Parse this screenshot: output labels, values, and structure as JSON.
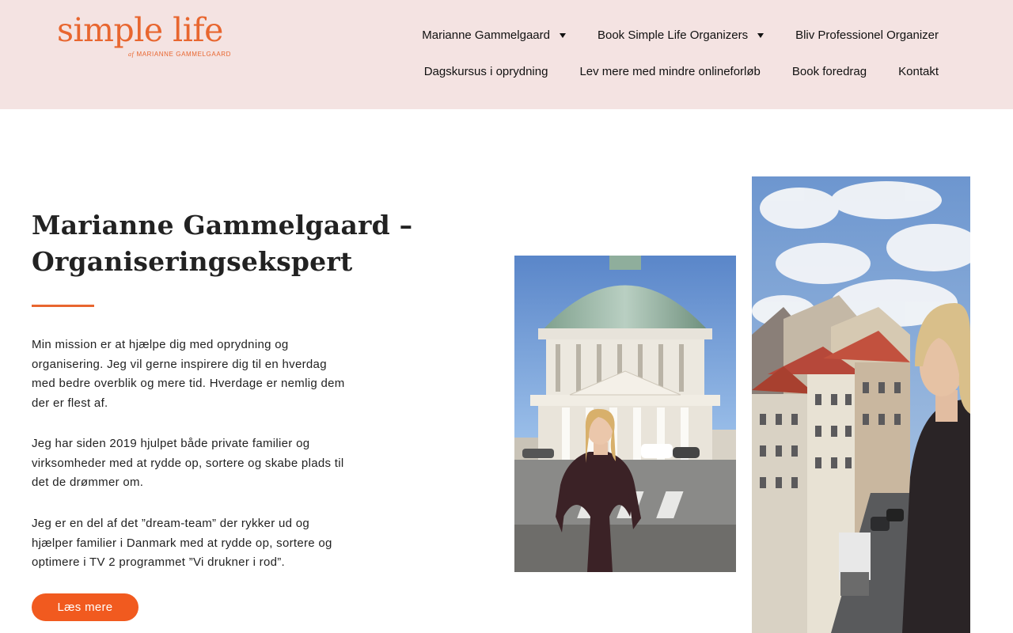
{
  "logo": {
    "wordmark": "simple life",
    "sub_prefix": "af",
    "sub_name": "MARIANNE GAMMELGAARD"
  },
  "nav": {
    "row1": [
      {
        "label": "Marianne Gammelgaard",
        "dropdown": true
      },
      {
        "label": "Book Simple Life Organizers",
        "dropdown": true
      },
      {
        "label": "Bliv Professionel Organizer",
        "dropdown": false
      }
    ],
    "row2": [
      {
        "label": "Dagskursus i oprydning",
        "dropdown": false
      },
      {
        "label": "Lev mere med mindre onlineforløb",
        "dropdown": false
      },
      {
        "label": "Book foredrag",
        "dropdown": false
      },
      {
        "label": "Kontakt",
        "dropdown": false
      }
    ]
  },
  "hero": {
    "title": "Marianne Gammelgaard – Organiseringsekspert",
    "paragraphs": [
      "Min mission er at hjælpe dig med oprydning og organisering. Jeg vil gerne inspirere dig til en hverdag med bedre overblik og mere tid. Hverdage er nemlig dem der er flest af.",
      "Jeg har siden 2019 hjulpet både private familier og virksomheder med at rydde op, sortere og skabe plads til det de drømmer om.",
      "Jeg er en del af det ”dream-team” der rykker ud og hjælper familier i Danmark med at rydde op, sortere og optimere i TV 2 programmet ”Vi drukner i rod”."
    ],
    "button_label": "Læs mere"
  },
  "colors": {
    "accent": "#e8662f",
    "button": "#f15a1f",
    "header_bg": "#f4e3e2"
  }
}
